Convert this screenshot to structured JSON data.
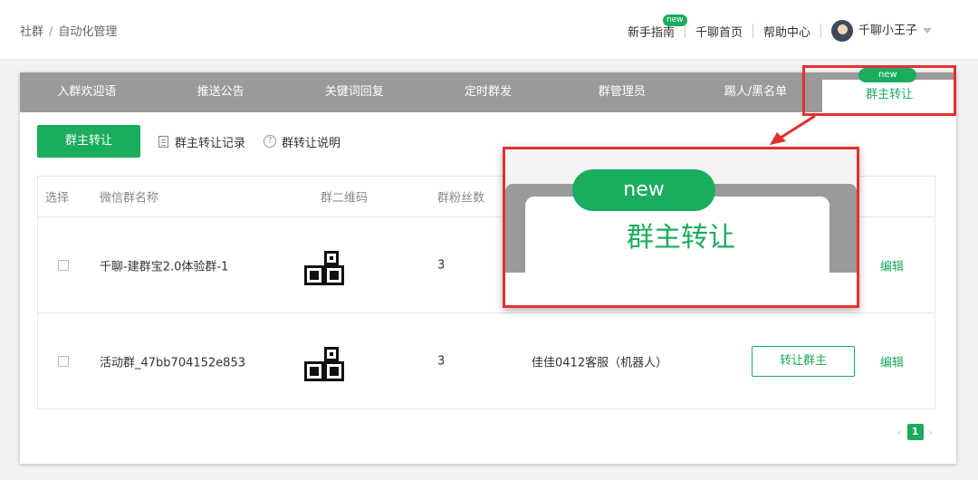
{
  "breadcrumb": {
    "root": "社群",
    "separator": "/",
    "current": "自动化管理"
  },
  "topnav": {
    "guide": "新手指南",
    "guide_badge": "new",
    "home": "千聊首页",
    "help": "帮助中心",
    "user": "千聊小王子"
  },
  "tabs": [
    {
      "label": "入群欢迎语"
    },
    {
      "label": "推送公告"
    },
    {
      "label": "关键词回复"
    },
    {
      "label": "定时群发"
    },
    {
      "label": "群管理员"
    },
    {
      "label": "踢人/黑名单"
    },
    {
      "label": "群主转让",
      "badge": "new",
      "active": true
    }
  ],
  "actions": {
    "primary": "群主转让",
    "records": "群主转让记录",
    "help": "群转让说明",
    "help_icon": "?"
  },
  "table": {
    "headers": [
      "选择",
      "微信群名称",
      "群二维码",
      "群粉丝数"
    ],
    "rows": [
      {
        "name": "千聊-建群宝2.0体验群-1",
        "fans": "3",
        "owner": "",
        "transfer": "",
        "edit": "编辑"
      },
      {
        "name": "活动群_47bb704152e853",
        "fans": "3",
        "owner": "佳佳0412客服（机器人）",
        "transfer": "转让群主",
        "edit": "编辑"
      }
    ]
  },
  "pager": {
    "prev": "‹",
    "current": "1",
    "next": "›"
  },
  "callout": {
    "badge": "new",
    "label": "群主转让"
  },
  "colors": {
    "accent": "#1aad5e",
    "highlight": "#e53030",
    "tab_bar": "#9a9a9a"
  }
}
